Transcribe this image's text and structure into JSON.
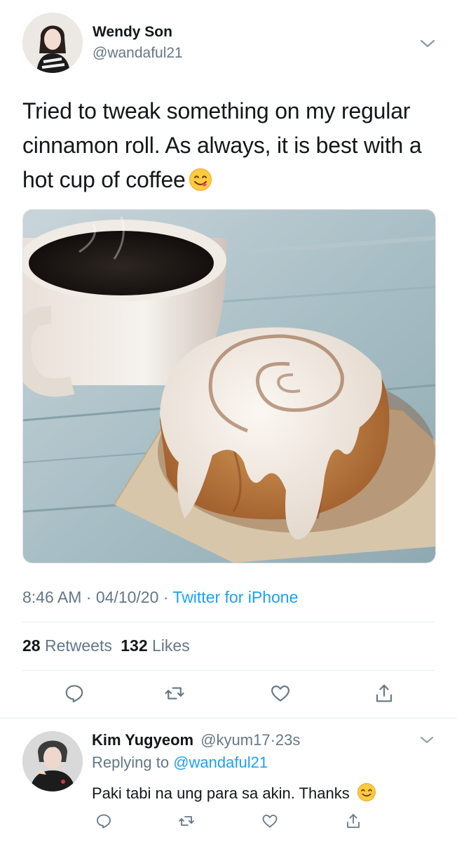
{
  "tweet": {
    "author_name": "Wendy Son",
    "author_handle": "@wandaful21",
    "text": "Tried to tweak something on my regular cinnamon roll. As always, it is best with a hot cup of coffee",
    "emoji": "smiling-face-savoring-food",
    "time": "8:46 AM",
    "separator": "·",
    "date": "04/10/20",
    "source": "Twitter for iPhone",
    "retweets_count": "28",
    "retweets_label": "Retweets",
    "likes_count": "132",
    "likes_label": "Likes"
  },
  "reply": {
    "author_name": "Kim Yugyeom",
    "author_handle": "@kyum17",
    "separator": "·",
    "time": "23s",
    "replying_prefix": "Replying to",
    "replying_to": "@wandaful21",
    "text": "Paki tabi na ung para sa akin. Thanks",
    "emoji": "smiling-face"
  },
  "icons": {
    "reply": "reply-icon",
    "retweet": "retweet-icon",
    "like": "heart-icon",
    "share": "share-icon",
    "more": "chevron-down-icon"
  },
  "colors": {
    "accent": "#1da1f2",
    "secondary_text": "#657786",
    "primary_text": "#14171a",
    "divider": "#e6ecf0"
  }
}
